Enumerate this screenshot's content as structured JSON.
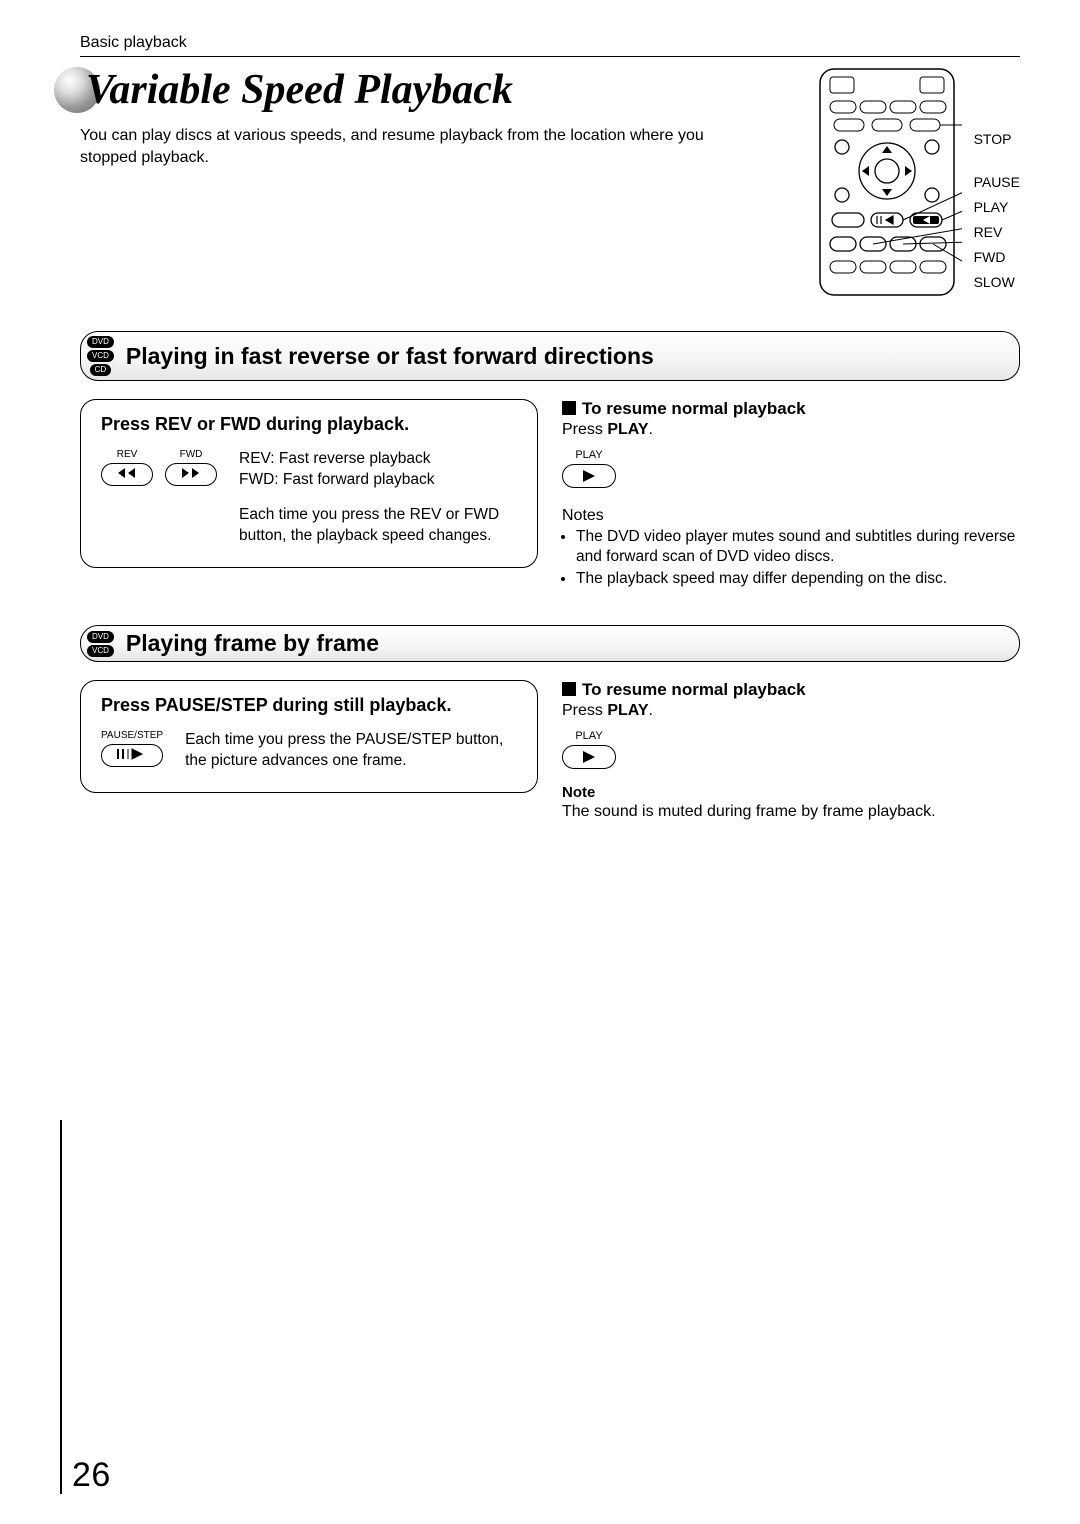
{
  "header": {
    "breadcrumb": "Basic playback"
  },
  "title": {
    "text": "Variable Speed Playback"
  },
  "intro": "You can play discs at various speeds, and resume playback from the location where you stopped playback.",
  "remote_labels": [
    "STOP",
    "PAUSE",
    "PLAY",
    "REV",
    "FWD",
    "SLOW"
  ],
  "section1": {
    "badges": [
      "DVD",
      "VCD",
      "CD"
    ],
    "title": "Playing in fast reverse or fast forward directions",
    "step_title": "Press REV or FWD during playback.",
    "key_labels": {
      "rev": "REV",
      "fwd": "FWD"
    },
    "line1": "REV:  Fast reverse playback",
    "line2": "FWD: Fast forward playback",
    "para": "Each time you press the REV or FWD button, the playback speed changes.",
    "resume_h": "To resume normal playback",
    "resume_pre": "Press ",
    "resume_btn": "PLAY",
    "resume_post": ".",
    "play_label": "PLAY",
    "notes_h": "Notes",
    "notes": [
      "The DVD video player mutes sound and subtitles during reverse and forward scan of DVD video discs.",
      "The playback speed may differ depending on the disc."
    ]
  },
  "section2": {
    "badges": [
      "DVD",
      "VCD"
    ],
    "title": "Playing frame by frame",
    "step_title": "Press PAUSE/STEP during still playback.",
    "key_label": "PAUSE/STEP",
    "para": "Each time you press the PAUSE/STEP button, the picture advances one frame.",
    "resume_h": "To resume normal playback",
    "resume_pre": "Press ",
    "resume_btn": "PLAY",
    "resume_post": ".",
    "play_label": "PLAY",
    "note_h": "Note",
    "note": "The sound is muted during frame by frame playback."
  },
  "page_number": "26"
}
